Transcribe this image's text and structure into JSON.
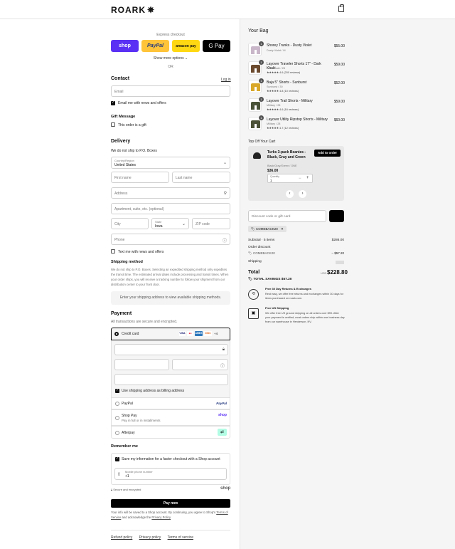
{
  "header": {
    "brand": "ROARK",
    "brand_mark": "✵"
  },
  "express": {
    "title": "Express checkout",
    "buttons": [
      "shop",
      "PayPal",
      "amazon pay",
      "G Pay"
    ],
    "more_options": "Show more options ⌄",
    "or": "OR"
  },
  "contact": {
    "title": "Contact",
    "login": "Log in",
    "email_placeholder": "Email",
    "news_label": "Email me with news and offers"
  },
  "gift": {
    "title": "Gift Message",
    "label": "This order is a gift"
  },
  "delivery": {
    "title": "Delivery",
    "note": "We do not ship to P.O. Boxes",
    "country_label": "Country/Region",
    "country_value": "United States",
    "first_name": "First name",
    "last_name": "Last name",
    "address": "Address",
    "apartment": "Apartment, suite, etc. (optional)",
    "city": "City",
    "state_label": "State",
    "state_value": "Iowa",
    "zip": "ZIP code",
    "phone": "Phone",
    "text_label": "Text me with news and offers"
  },
  "shipping_method": {
    "title": "Shipping method",
    "text": "We do not ship to P.O. Boxes. Selecting an expedited shipping method only expedites the transit time. The estimated arrival dates include processing and transit times. When your order ships, you will receive a tracking number to follow your shipment from our distribution center to your front door.",
    "box": "Enter your shipping address to view available shipping methods."
  },
  "payment": {
    "title": "Payment",
    "subtitle": "All transactions are secure and encrypted.",
    "credit_card": "Credit card",
    "more_cards": "+4",
    "billing_label": "Use shipping address as billing address",
    "paypal": "PayPal",
    "shop_pay": "Shop Pay",
    "shop_pay_sub": "Pay in full or in installments",
    "afterpay": "Afterpay"
  },
  "remember": {
    "title": "Remember me",
    "save_label": "Save my information for a faster checkout with a Shop account",
    "mobile_label": "Mobile phone number",
    "mobile_value": "+1",
    "secure": "Secure and encrypted",
    "shop_logo": "shop"
  },
  "pay_now": "Pay now",
  "legal": {
    "line1": "Your info will be saved to a Shop account. By continuing, you agree to Shop's",
    "terms": "Terms of Service",
    "middle": "and acknowledge the",
    "privacy": "Privacy Policy"
  },
  "footer": [
    "Refund policy",
    "Privacy policy",
    "Terms of service"
  ],
  "bag": {
    "title": "Your Bag",
    "items": [
      {
        "qty": "1",
        "name": "Shorey Trunks - Dusty Violet",
        "sub": "Dusty Violet / M",
        "rating": "",
        "price": "$55.00",
        "color": "#c9b7c9"
      },
      {
        "qty": "1",
        "name": "Layover Traveler Shorts 17\" - Dark Khaki",
        "sub": "Dark Khaki / 28",
        "rating": "★★★★★ 4.6 (200 reviews)",
        "price": "$59.00",
        "color": "#6b4a2e"
      },
      {
        "qty": "1",
        "name": "Baja 5\" Shorts - Sunburst",
        "sub": "Sunburst / 30",
        "rating": "★★★★★ 4.8 (10 reviews)",
        "price": "$52.00",
        "color": "#d9a82a"
      },
      {
        "qty": "1",
        "name": "Layover Trail Shorts - Military",
        "sub": "Military / 28",
        "rating": "★★★★★ 4.6 (16 reviews)",
        "price": "$59.00",
        "color": "#4a5238"
      },
      {
        "qty": "1",
        "name": "Layover Utility Ripstop Shorts - Military",
        "sub": "Military / 28",
        "rating": "★★★★★ 4.7 (12 reviews)",
        "price": "$60.00",
        "color": "#4b5136"
      }
    ]
  },
  "upsell": {
    "title": "Top Off Your Cart",
    "name": "Turks 3-pack Beanies - Black, Gray and Green",
    "sub": "Black/Gray/Green / ONE",
    "price": "$36.00",
    "add": "Add to order",
    "qty_label": "Quantity",
    "qty_value": "1"
  },
  "discount": {
    "placeholder": "Discount code or gift card",
    "code": "COMEBACK20"
  },
  "summary": {
    "subtotal_label": "Subtotal · 5 items",
    "subtotal": "$286.00",
    "order_discount": "Order discount",
    "code": "COMEBACK20",
    "discount_value": "– $57.20",
    "shipping": "Shipping",
    "total_label": "Total",
    "currency": "USD",
    "total": "$228.80",
    "savings": "TOTAL SAVINGS $57.20"
  },
  "perks": [
    {
      "title": "Free 30 Day Returns & Exchanges",
      "text": "Rest easy, we offer free returns and exchanges within 30 days for items purchased on roark.com."
    },
    {
      "title": "Free US Shipping",
      "text": "We offer free US ground shipping on all orders over $99. After your payment is verified, most orders ship within one business day from our warehouse in Henderson, NV."
    }
  ]
}
